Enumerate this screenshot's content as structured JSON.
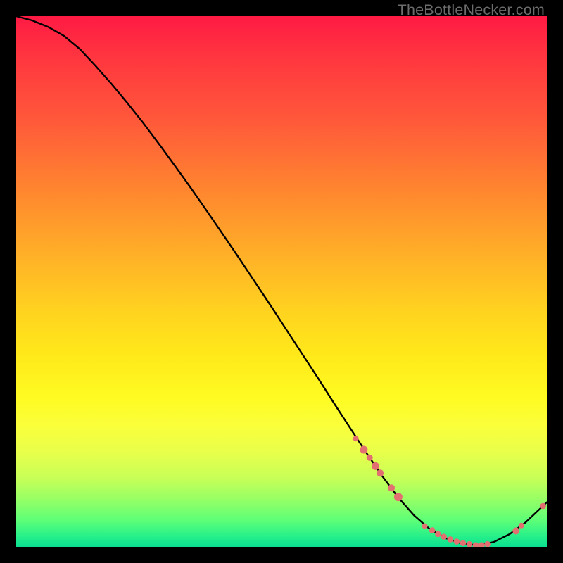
{
  "attribution": "TheBottleNecker.com",
  "chart_data": {
    "type": "line",
    "title": "",
    "xlabel": "",
    "ylabel": "",
    "xlim": [
      0,
      100
    ],
    "ylim": [
      0,
      100
    ],
    "background_gradient": [
      "#ff1a44",
      "#ffd41f",
      "#fffb22",
      "#0adf90"
    ],
    "curve_color": "#000000",
    "marker_color": "#e37070",
    "series": [
      {
        "name": "curve",
        "x": [
          0,
          3,
          6,
          9,
          12,
          15,
          18,
          21,
          24,
          27,
          30,
          33,
          36,
          39,
          42,
          45,
          48,
          51,
          54,
          57,
          60,
          63,
          66,
          69,
          72,
          75,
          78,
          81,
          84,
          87,
          90,
          93,
          96,
          100
        ],
        "y": [
          100,
          99.2,
          98.0,
          96.3,
          93.8,
          90.6,
          87.2,
          83.6,
          79.8,
          75.8,
          71.7,
          67.5,
          63.2,
          58.8,
          54.4,
          49.9,
          45.4,
          40.8,
          36.2,
          31.6,
          26.9,
          22.3,
          17.7,
          13.3,
          9.3,
          5.9,
          3.3,
          1.6,
          0.6,
          0.3,
          0.9,
          2.4,
          4.6,
          8.4
        ]
      }
    ],
    "markers": [
      {
        "x": 64.0,
        "y": 20.4,
        "r": 4.0
      },
      {
        "x": 65.5,
        "y": 18.3,
        "r": 5.5
      },
      {
        "x": 66.6,
        "y": 16.8,
        "r": 4.5
      },
      {
        "x": 67.7,
        "y": 15.2,
        "r": 5.5
      },
      {
        "x": 68.6,
        "y": 13.9,
        "r": 5.0
      },
      {
        "x": 70.7,
        "y": 11.1,
        "r": 5.0
      },
      {
        "x": 72.0,
        "y": 9.4,
        "r": 6.0
      },
      {
        "x": 77.0,
        "y": 3.9,
        "r": 4.0
      },
      {
        "x": 78.4,
        "y": 3.1,
        "r": 4.3
      },
      {
        "x": 79.5,
        "y": 2.4,
        "r": 4.3
      },
      {
        "x": 80.6,
        "y": 1.9,
        "r": 4.3
      },
      {
        "x": 81.8,
        "y": 1.4,
        "r": 4.3
      },
      {
        "x": 83.0,
        "y": 1.0,
        "r": 4.3
      },
      {
        "x": 84.2,
        "y": 0.7,
        "r": 4.3
      },
      {
        "x": 85.4,
        "y": 0.5,
        "r": 4.3
      },
      {
        "x": 86.6,
        "y": 0.3,
        "r": 4.3
      },
      {
        "x": 87.7,
        "y": 0.3,
        "r": 4.3
      },
      {
        "x": 88.8,
        "y": 0.5,
        "r": 4.3
      },
      {
        "x": 94.2,
        "y": 3.0,
        "r": 5.0
      },
      {
        "x": 95.2,
        "y": 4.0,
        "r": 4.0
      },
      {
        "x": 99.3,
        "y": 7.7,
        "r": 4.3
      }
    ]
  }
}
